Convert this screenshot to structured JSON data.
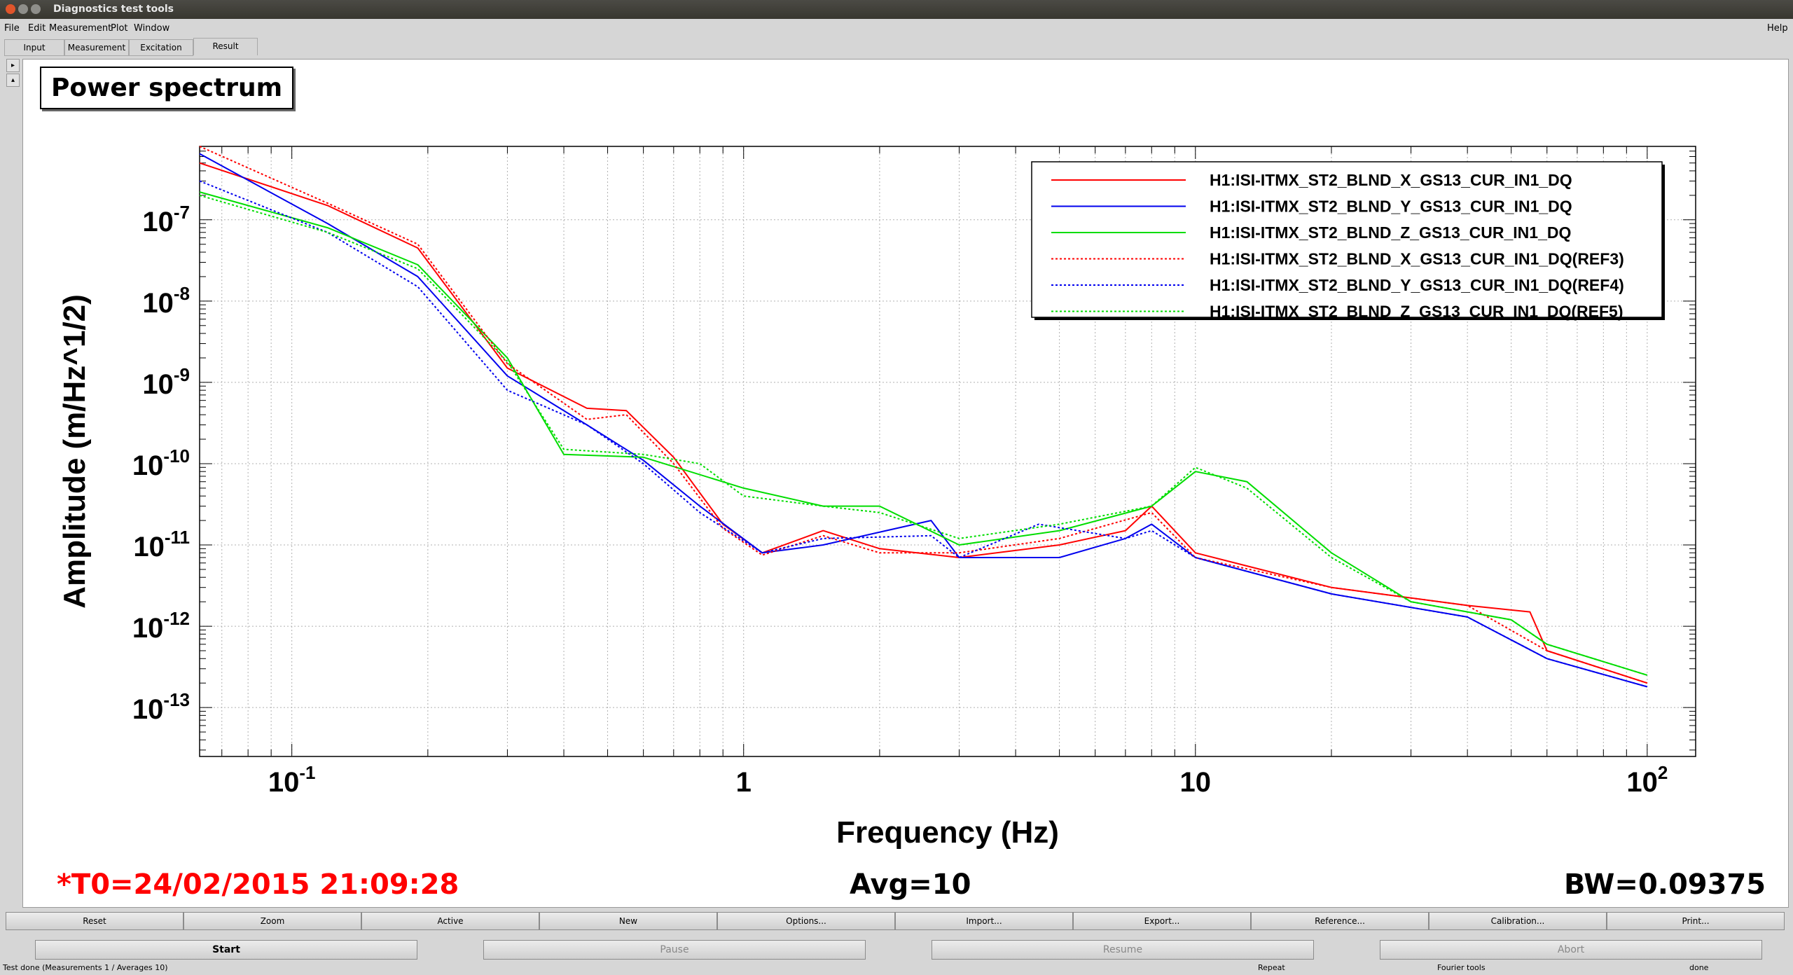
{
  "window": {
    "title": "Diagnostics test tools"
  },
  "menu": {
    "file": "File",
    "edit": "Edit",
    "measurement": "Measurement",
    "plot": "Plot",
    "window": "Window",
    "help": "Help"
  },
  "tabs": [
    "Input",
    "Measurement",
    "Excitation",
    "Result"
  ],
  "active_tab": "Result",
  "plot_panel_title": "Power spectrum",
  "chart_data": {
    "type": "line",
    "xlabel": "Frequency (Hz)",
    "ylabel": "Amplitude (m/Hz^1/2)",
    "xscale": "log",
    "yscale": "log",
    "xlim": [
      0.0625,
      128
    ],
    "ylim": [
      2.5e-14,
      8e-07
    ],
    "x_ticks": [
      {
        "value": 0.1,
        "base": "10",
        "exp": "-1"
      },
      {
        "value": 1,
        "base": "1",
        "exp": ""
      },
      {
        "value": 10,
        "base": "10",
        "exp": ""
      },
      {
        "value": 100,
        "base": "10",
        "exp": "2"
      }
    ],
    "y_ticks": [
      {
        "value": 1e-07,
        "base": "10",
        "exp": "-7"
      },
      {
        "value": 1e-08,
        "base": "10",
        "exp": "-8"
      },
      {
        "value": 1e-09,
        "base": "10",
        "exp": "-9"
      },
      {
        "value": 1e-10,
        "base": "10",
        "exp": "-10"
      },
      {
        "value": 1e-11,
        "base": "10",
        "exp": "-11"
      },
      {
        "value": 1e-12,
        "base": "10",
        "exp": "-12"
      },
      {
        "value": 1e-13,
        "base": "10",
        "exp": "-13"
      }
    ],
    "grid": true,
    "legend_position": "top-right",
    "series": [
      {
        "name": "H1:ISI-ITMX_ST2_BLND_X_GS13_CUR_IN1_DQ",
        "color": "#ff0000",
        "style": "solid",
        "points": [
          [
            0.0625,
            5e-07
          ],
          [
            0.12,
            1.5e-07
          ],
          [
            0.19,
            4.5e-08
          ],
          [
            0.3,
            1.5e-09
          ],
          [
            0.45,
            4.8e-10
          ],
          [
            0.55,
            4.5e-10
          ],
          [
            0.7,
            1.2e-10
          ],
          [
            0.9,
            1.8e-11
          ],
          [
            1.1,
            8e-12
          ],
          [
            1.5,
            1.5e-11
          ],
          [
            2,
            9e-12
          ],
          [
            3,
            7e-12
          ],
          [
            5,
            1e-11
          ],
          [
            7,
            1.5e-11
          ],
          [
            8,
            3e-11
          ],
          [
            10,
            8e-12
          ],
          [
            20,
            3e-12
          ],
          [
            40,
            1.8e-12
          ],
          [
            55,
            1.5e-12
          ],
          [
            60,
            5e-13
          ],
          [
            100,
            2e-13
          ]
        ]
      },
      {
        "name": "H1:ISI-ITMX_ST2_BLND_Y_GS13_CUR_IN1_DQ",
        "color": "#0000ee",
        "style": "solid",
        "points": [
          [
            0.0625,
            6.5e-07
          ],
          [
            0.12,
            9e-08
          ],
          [
            0.19,
            2e-08
          ],
          [
            0.3,
            1.2e-09
          ],
          [
            0.45,
            3e-10
          ],
          [
            0.6,
            1.1e-10
          ],
          [
            0.8,
            3e-11
          ],
          [
            1.1,
            8e-12
          ],
          [
            1.5,
            1e-11
          ],
          [
            2.6,
            2e-11
          ],
          [
            3,
            7e-12
          ],
          [
            5,
            7e-12
          ],
          [
            7,
            1.2e-11
          ],
          [
            8,
            1.8e-11
          ],
          [
            10,
            7e-12
          ],
          [
            20,
            2.5e-12
          ],
          [
            40,
            1.3e-12
          ],
          [
            60,
            4e-13
          ],
          [
            100,
            1.8e-13
          ]
        ]
      },
      {
        "name": "H1:ISI-ITMX_ST2_BLND_Z_GS13_CUR_IN1_DQ",
        "color": "#00dd00",
        "style": "solid",
        "points": [
          [
            0.0625,
            2.2e-07
          ],
          [
            0.12,
            8e-08
          ],
          [
            0.19,
            2.8e-08
          ],
          [
            0.3,
            2e-09
          ],
          [
            0.4,
            1.3e-10
          ],
          [
            0.6,
            1.2e-10
          ],
          [
            1,
            5e-11
          ],
          [
            1.5,
            3e-11
          ],
          [
            2,
            3e-11
          ],
          [
            3,
            1e-11
          ],
          [
            5,
            1.5e-11
          ],
          [
            8,
            3e-11
          ],
          [
            10,
            8e-11
          ],
          [
            13,
            6e-11
          ],
          [
            20,
            8e-12
          ],
          [
            30,
            2e-12
          ],
          [
            50,
            1.2e-12
          ],
          [
            60,
            6e-13
          ],
          [
            100,
            2.5e-13
          ]
        ]
      },
      {
        "name": "H1:ISI-ITMX_ST2_BLND_X_GS13_CUR_IN1_DQ(REF3)",
        "color": "#ff0000",
        "style": "dotted",
        "points": [
          [
            0.0625,
            8e-07
          ],
          [
            0.12,
            1.6e-07
          ],
          [
            0.19,
            5e-08
          ],
          [
            0.3,
            1.7e-09
          ],
          [
            0.45,
            3.5e-10
          ],
          [
            0.55,
            4e-10
          ],
          [
            0.7,
            1e-10
          ],
          [
            0.9,
            1.6e-11
          ],
          [
            1.1,
            7.5e-12
          ],
          [
            1.5,
            1.3e-11
          ],
          [
            2,
            8e-12
          ],
          [
            3,
            8e-12
          ],
          [
            5,
            1.2e-11
          ],
          [
            8,
            2.5e-11
          ],
          [
            10,
            7e-12
          ],
          [
            20,
            3e-12
          ],
          [
            40,
            1.8e-12
          ],
          [
            60,
            5e-13
          ],
          [
            100,
            2e-13
          ]
        ]
      },
      {
        "name": "H1:ISI-ITMX_ST2_BLND_Y_GS13_CUR_IN1_DQ(REF4)",
        "color": "#0000ee",
        "style": "dotted",
        "points": [
          [
            0.0625,
            3e-07
          ],
          [
            0.12,
            7e-08
          ],
          [
            0.19,
            1.5e-08
          ],
          [
            0.3,
            8e-10
          ],
          [
            0.45,
            3e-10
          ],
          [
            0.6,
            1e-10
          ],
          [
            0.8,
            2.5e-11
          ],
          [
            1.1,
            8e-12
          ],
          [
            1.5,
            1.2e-11
          ],
          [
            2.6,
            1.3e-11
          ],
          [
            3,
            7e-12
          ],
          [
            4.5,
            1.8e-11
          ],
          [
            7,
            1.2e-11
          ],
          [
            8,
            1.5e-11
          ],
          [
            10,
            7e-12
          ],
          [
            20,
            2.5e-12
          ],
          [
            40,
            1.3e-12
          ],
          [
            60,
            4e-13
          ],
          [
            100,
            1.8e-13
          ]
        ]
      },
      {
        "name": "H1:ISI-ITMX_ST2_BLND_Z_GS13_CUR_IN1_DQ(REF5)",
        "color": "#00dd00",
        "style": "dotted",
        "points": [
          [
            0.0625,
            2e-07
          ],
          [
            0.12,
            7e-08
          ],
          [
            0.19,
            2.5e-08
          ],
          [
            0.3,
            1.8e-09
          ],
          [
            0.4,
            1.5e-10
          ],
          [
            0.6,
            1.3e-10
          ],
          [
            0.8,
            1e-10
          ],
          [
            1,
            4e-11
          ],
          [
            1.5,
            3e-11
          ],
          [
            2,
            2.5e-11
          ],
          [
            3,
            1.2e-11
          ],
          [
            5,
            1.8e-11
          ],
          [
            8,
            3e-11
          ],
          [
            10,
            9e-11
          ],
          [
            13,
            5e-11
          ],
          [
            20,
            7e-12
          ],
          [
            30,
            2e-12
          ],
          [
            50,
            1.2e-12
          ],
          [
            60,
            6e-13
          ],
          [
            100,
            2.5e-13
          ]
        ]
      }
    ]
  },
  "footer": {
    "t0": "*T0=24/02/2015 21:09:28",
    "avg": "Avg=10",
    "bw": "BW=0.09375"
  },
  "buttons_row1": [
    "Reset",
    "Zoom",
    "Active",
    "New",
    "Options...",
    "Import...",
    "Export...",
    "Reference...",
    "Calibration...",
    "Print..."
  ],
  "buttons_row2": {
    "start": "Start",
    "pause": "Pause",
    "resume": "Resume",
    "abort": "Abort"
  },
  "status": {
    "left": "Test done (Measurements 1 / Averages 10)",
    "repeat": "Repeat",
    "tools": "Fourier tools",
    "state": "done"
  },
  "colors": {
    "x_channel": "#ff0000",
    "y_channel": "#0000ee",
    "z_channel": "#00dd00",
    "timestamp": "#ff0000"
  }
}
